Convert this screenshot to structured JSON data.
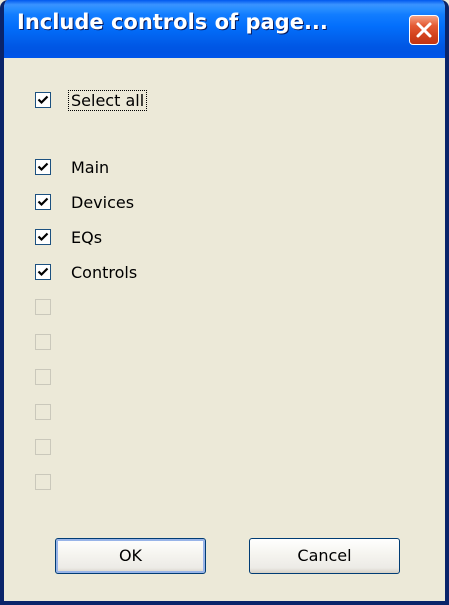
{
  "dialog": {
    "title": "Include controls of page...",
    "select_all_label": "Select all",
    "select_all_checked": true
  },
  "pages": [
    {
      "label": "Main",
      "checked": true,
      "enabled": true
    },
    {
      "label": "Devices",
      "checked": true,
      "enabled": true
    },
    {
      "label": "EQs",
      "checked": true,
      "enabled": true
    },
    {
      "label": "Controls",
      "checked": true,
      "enabled": true
    },
    {
      "label": "",
      "checked": false,
      "enabled": false
    },
    {
      "label": "",
      "checked": false,
      "enabled": false
    },
    {
      "label": "",
      "checked": false,
      "enabled": false
    },
    {
      "label": "",
      "checked": false,
      "enabled": false
    },
    {
      "label": "",
      "checked": false,
      "enabled": false
    },
    {
      "label": "",
      "checked": false,
      "enabled": false
    }
  ],
  "buttons": {
    "ok_label": "OK",
    "cancel_label": "Cancel"
  },
  "colors": {
    "titlebar": "#0055EA",
    "dialog_bg": "#ECE9D8",
    "close_button": "#D2411C"
  }
}
